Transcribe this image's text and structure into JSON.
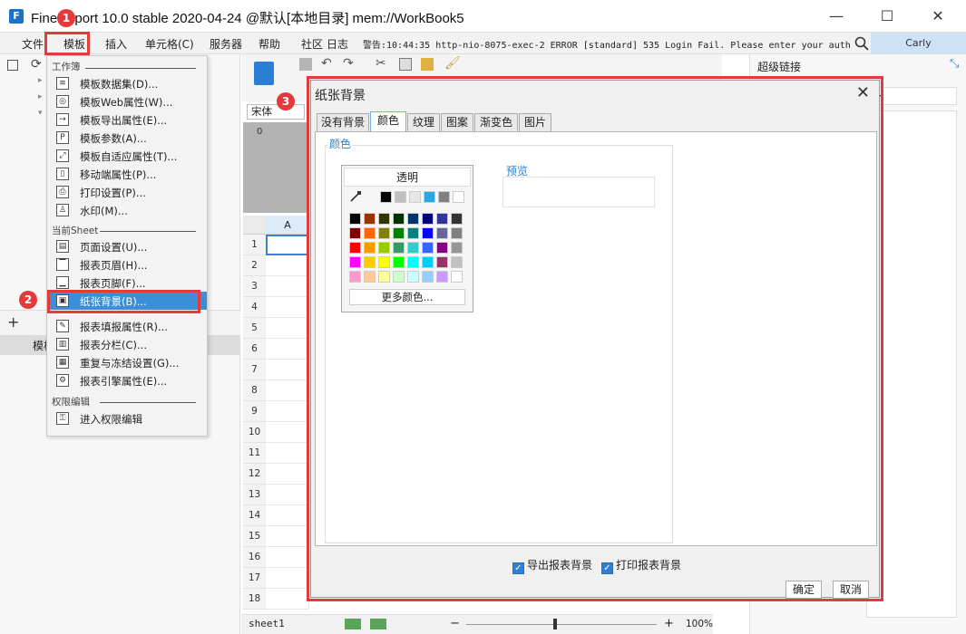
{
  "window": {
    "logo_glyph": "F",
    "title": "FineReport 10.0 stable 2020-04-24 @默认[本地目录]    mem://WorkBook5",
    "minimize": "—",
    "maximize": "☐",
    "close": "✕"
  },
  "menubar": {
    "items": [
      "文件",
      "模板",
      "插入",
      "单元格(C)",
      "服务器",
      "帮助",
      "社区",
      "日志"
    ],
    "warning": "警告:10:44:35 http-nio-8075-exec-2 ERROR [standard] 535 Login Fail. Please enter your auth...",
    "user": "Carly"
  },
  "dropdown": {
    "sec_workbook": "工作簿",
    "sec_sheet": "当前Sheet",
    "sec_perm": "权限编辑",
    "items": [
      {
        "label": "模板数据集(D)...",
        "icon": "database-icon",
        "glyph": "≡"
      },
      {
        "label": "模板Web属性(W)...",
        "icon": "web-icon",
        "glyph": "◎"
      },
      {
        "label": "模板导出属性(E)...",
        "icon": "export-icon",
        "glyph": "→"
      },
      {
        "label": "模板参数(A)...",
        "icon": "parameter-icon",
        "glyph": "P"
      },
      {
        "label": "模板自适应属性(T)...",
        "icon": "adaptive-icon",
        "glyph": "⤢"
      },
      {
        "label": "移动端属性(P)...",
        "icon": "mobile-icon",
        "glyph": "▯"
      },
      {
        "label": "打印设置(P)...",
        "icon": "printer-icon",
        "glyph": "⎙"
      },
      {
        "label": "水印(M)...",
        "icon": "watermark-icon",
        "glyph": "♙"
      },
      {
        "label": "页面设置(U)...",
        "icon": "page-setup-icon",
        "glyph": "▤"
      },
      {
        "label": "报表页眉(H)...",
        "icon": "header-icon",
        "glyph": "▔"
      },
      {
        "label": "报表页脚(F)...",
        "icon": "footer-icon",
        "glyph": "▁"
      },
      {
        "label": "纸张背景(B)...",
        "icon": "paper-background-icon",
        "glyph": "▣"
      },
      {
        "label": "报表填报属性(R)...",
        "icon": "fill-report-icon",
        "glyph": "✎"
      },
      {
        "label": "报表分栏(C)...",
        "icon": "columns-icon",
        "glyph": "▥"
      },
      {
        "label": "重复与冻结设置(G)...",
        "icon": "freeze-icon",
        "glyph": "▦"
      },
      {
        "label": "报表引擎属性(E)...",
        "icon": "engine-icon",
        "glyph": "⚙"
      },
      {
        "label": "进入权限编辑",
        "icon": "permission-icon",
        "glyph": "⚿"
      }
    ]
  },
  "editor": {
    "font_box": "宋体",
    "ruler_zero": "0",
    "col_a": "A",
    "row_numbers": [
      "1",
      "2",
      "3",
      "4",
      "5",
      "6",
      "7",
      "8",
      "9",
      "10",
      "11",
      "12",
      "13",
      "14",
      "15",
      "16",
      "17",
      "18"
    ],
    "sheet_tab": "sheet1",
    "zoom": "100%",
    "left_tree_label": "模板"
  },
  "right_panel": {
    "title": "超级链接",
    "add": "+"
  },
  "dialog": {
    "title": "纸张背景",
    "tabs": [
      "没有背景",
      "颜色",
      "纹理",
      "图案",
      "渐变色",
      "图片"
    ],
    "active_tab": "颜色",
    "group_label": "颜色",
    "palette_header": "透明",
    "more_colors": "更多颜色...",
    "preview_label": "预览",
    "export_bg": "导出报表背景",
    "print_bg": "打印报表背景",
    "ok": "确定",
    "cancel": "取消",
    "top_row_colors": [
      "#000000",
      "#bfbfbf",
      "#e6e6e6",
      "#29a8e0",
      "#808080",
      "#ffffff"
    ],
    "grid_colors": [
      [
        "#000000",
        "#993300",
        "#333300",
        "#003300",
        "#003366",
        "#000080",
        "#333399",
        "#333333"
      ],
      [
        "#800000",
        "#ff6600",
        "#808000",
        "#008000",
        "#008080",
        "#0000ff",
        "#666699",
        "#808080"
      ],
      [
        "#ff0000",
        "#ff9900",
        "#99cc00",
        "#339966",
        "#33cccc",
        "#3366ff",
        "#800080",
        "#969696"
      ],
      [
        "#ff00ff",
        "#ffcc00",
        "#ffff00",
        "#00ff00",
        "#00ffff",
        "#00ccff",
        "#993366",
        "#c0c0c0"
      ],
      [
        "#ff99cc",
        "#ffcc99",
        "#ffff99",
        "#ccffcc",
        "#ccffff",
        "#99ccff",
        "#cc99ff",
        "#ffffff"
      ]
    ]
  },
  "badges": [
    "1",
    "2",
    "3"
  ]
}
